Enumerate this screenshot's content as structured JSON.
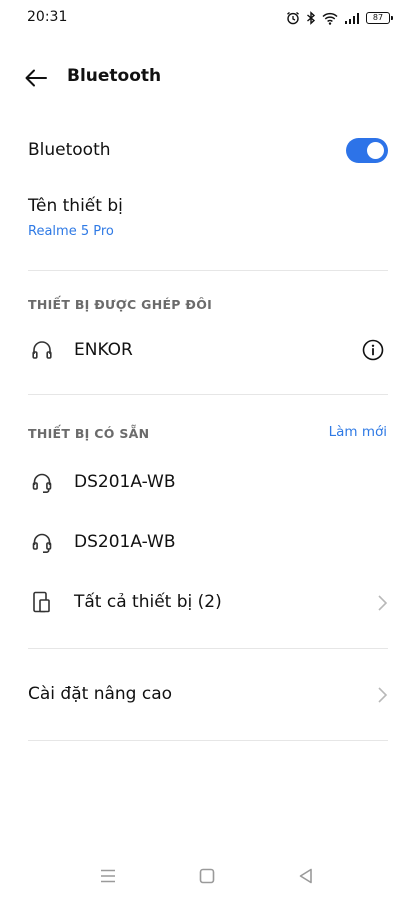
{
  "status_bar": {
    "time": "20:31",
    "battery_level": "87",
    "icons": [
      "alarm-icon",
      "bluetooth-icon",
      "wifi-icon",
      "signal-icon",
      "battery-icon"
    ]
  },
  "header": {
    "title": "Bluetooth"
  },
  "bluetooth_toggle": {
    "label": "Bluetooth",
    "on": true,
    "accent_color": "#2d73e8"
  },
  "device_name": {
    "label": "Tên thiết bị",
    "value": "Realme 5 Pro"
  },
  "paired_section": {
    "header": "THIẾT BỊ ĐƯỢC GHÉP ĐÔI",
    "devices": [
      {
        "name": "ENKOR",
        "icon": "headphones-icon"
      }
    ]
  },
  "available_section": {
    "header": "THIẾT BỊ CÓ SẴN",
    "refresh_label": "Làm mới",
    "devices": [
      {
        "name": "DS201A-WB",
        "icon": "headset-icon"
      },
      {
        "name": "DS201A-WB",
        "icon": "headset-icon"
      }
    ],
    "all_devices_label": "Tất cả thiết bị (2)"
  },
  "advanced": {
    "label": "Cài đặt nâng cao"
  },
  "colors": {
    "link_blue": "#2f7ae5",
    "section_gray": "#6b6b6b"
  }
}
